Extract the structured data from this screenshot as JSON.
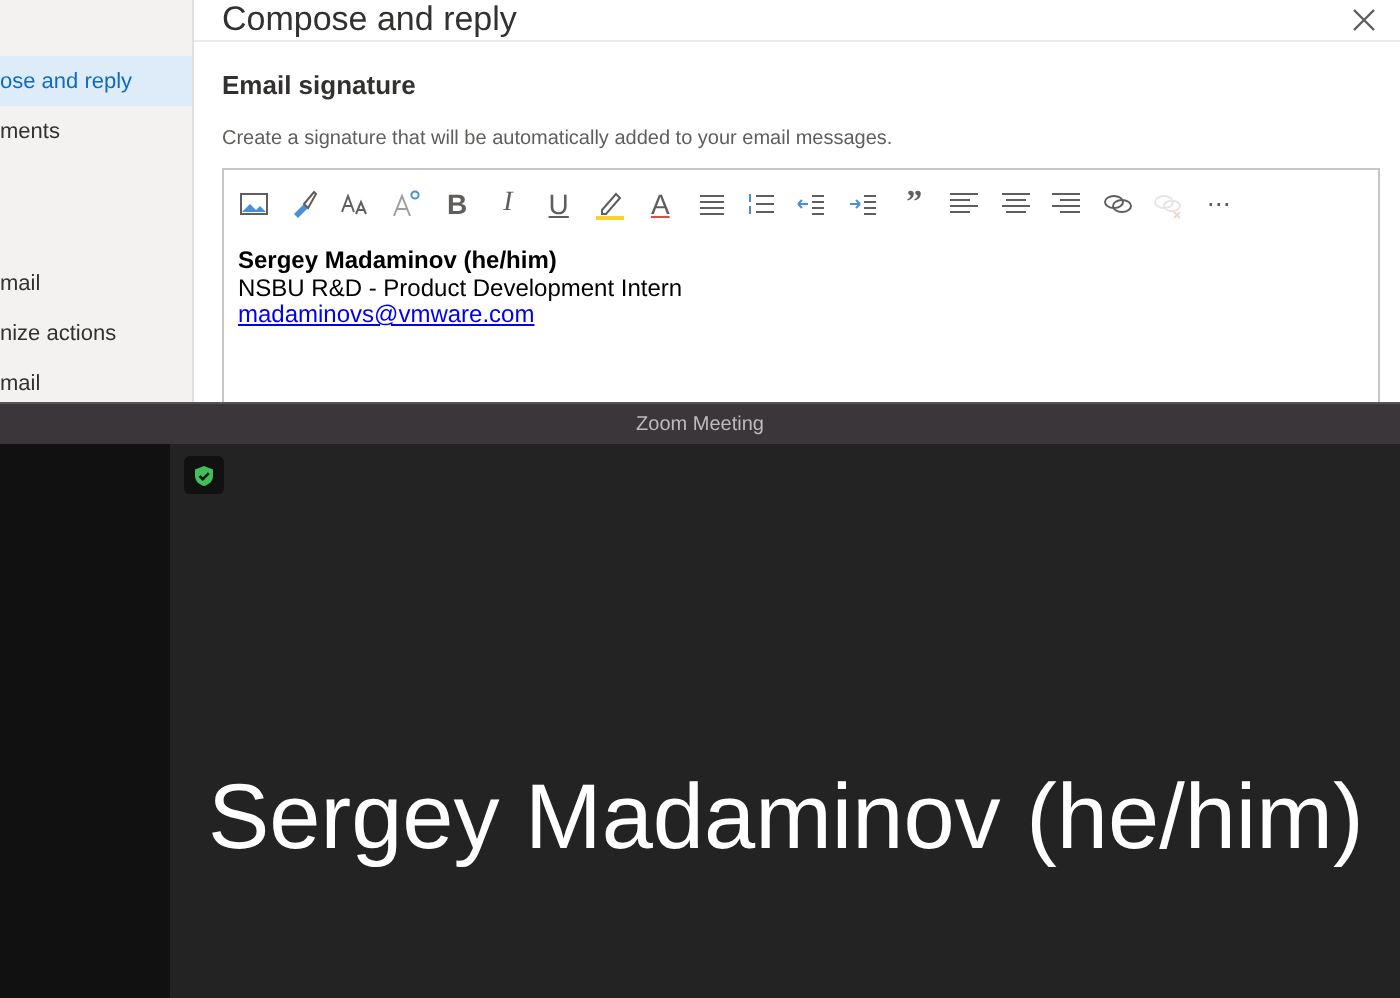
{
  "settings": {
    "sidebar": {
      "items": [
        {
          "label": "ose and reply",
          "selected": true
        },
        {
          "label": "ments",
          "selected": false
        },
        {
          "label": "mail",
          "selected": false
        },
        {
          "label": "nize actions",
          "selected": false
        },
        {
          "label": "mail",
          "selected": false
        }
      ]
    },
    "title": "Compose and reply",
    "section": {
      "heading": "Email signature",
      "description": "Create a signature that will be automatically added to your email messages."
    },
    "toolbar": [
      {
        "kind": "image",
        "disabled": false
      },
      {
        "kind": "painter",
        "disabled": false
      },
      {
        "kind": "font-size",
        "disabled": false
      },
      {
        "kind": "superscript",
        "disabled": false
      },
      {
        "kind": "bold",
        "label": "B",
        "disabled": false
      },
      {
        "kind": "italic",
        "label": "I",
        "disabled": false
      },
      {
        "kind": "underline",
        "label": "U",
        "disabled": false
      },
      {
        "kind": "highlight",
        "disabled": false
      },
      {
        "kind": "font-color",
        "label": "A",
        "disabled": false
      },
      {
        "kind": "bullets",
        "disabled": false
      },
      {
        "kind": "numbering",
        "disabled": false
      },
      {
        "kind": "outdent",
        "disabled": false
      },
      {
        "kind": "indent",
        "disabled": false
      },
      {
        "kind": "quote",
        "label": "”",
        "disabled": false
      },
      {
        "kind": "align-left",
        "disabled": false
      },
      {
        "kind": "align-center",
        "disabled": false
      },
      {
        "kind": "align-right",
        "disabled": false
      },
      {
        "kind": "link",
        "disabled": false
      },
      {
        "kind": "unlink",
        "disabled": true
      },
      {
        "kind": "more",
        "label": "⋯",
        "disabled": false
      }
    ],
    "signature": {
      "name": "Sergey Madaminov (he/him)",
      "role": "NSBU R&D - Product Development Intern",
      "email": "madaminovs@vmware.com"
    }
  },
  "zoom": {
    "title": "Zoom Meeting",
    "participant_name": "Sergey Madaminov (he/him)"
  }
}
